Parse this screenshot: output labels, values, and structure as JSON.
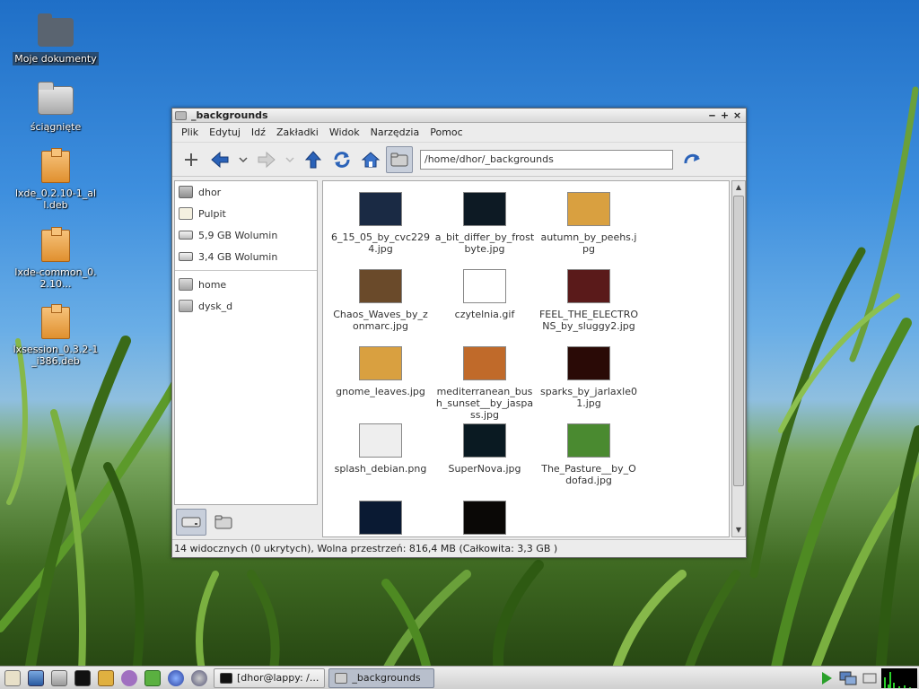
{
  "desktop": {
    "icons": [
      {
        "label": "Moje dokumenty",
        "type": "folder-home"
      },
      {
        "label": "ściągnięte",
        "type": "folder"
      },
      {
        "label": "lxde_0.2.10-1_all.deb",
        "type": "package"
      },
      {
        "label": "lxde-common_0.2.10...",
        "type": "package"
      },
      {
        "label": "lxsession_0.3.2-1_i386.deb",
        "type": "package"
      }
    ]
  },
  "window": {
    "title": "_backgrounds",
    "controls": {
      "minimize": "‒",
      "maximize": "+",
      "close": "×"
    },
    "menu": [
      "Plik",
      "Edytuj",
      "Idź",
      "Zakładki",
      "Widok",
      "Narzędzia",
      "Pomoc"
    ],
    "path": "/home/dhor/_backgrounds",
    "sidebar": {
      "places": [
        {
          "label": "dhor",
          "icon": "home-folder-icon"
        },
        {
          "label": "Pulpit",
          "icon": "desktop-icon"
        },
        {
          "label": "5,9 GB Wolumin",
          "icon": "drive-icon"
        },
        {
          "label": "3,4 GB Wolumin",
          "icon": "drive-icon"
        }
      ],
      "bookmarks": [
        {
          "label": "home",
          "icon": "folder-icon"
        },
        {
          "label": "dysk_d",
          "icon": "folder-icon"
        }
      ]
    },
    "files": [
      {
        "name": "6_15_05_by_cvc2294.jpg",
        "color": "#1a2a44"
      },
      {
        "name": "a_bit_differ_by_frostbyte.jpg",
        "color": "#0d1a24"
      },
      {
        "name": "autumn_by_peehs.jpg",
        "color": "#d9a040"
      },
      {
        "name": "Chaos_Waves_by_zonmarc.jpg",
        "color": "#6a4a2a"
      },
      {
        "name": "czytelnia.gif",
        "color": "#ffffff"
      },
      {
        "name": "FEEL_THE_ELECTRONS_by_sluggy2.jpg",
        "color": "#5a1a1a"
      },
      {
        "name": "gnome_leaves.jpg",
        "color": "#d9a040"
      },
      {
        "name": "mediterranean_bush_sunset__by_jaspass.jpg",
        "color": "#c06a2a"
      },
      {
        "name": "sparks_by_jarlaxle01.jpg",
        "color": "#2a0a06"
      },
      {
        "name": "splash_debian.png",
        "color": "#eeeeee"
      },
      {
        "name": "SuperNova.jpg",
        "color": "#0a1a22"
      },
      {
        "name": "The_Pasture__by_Odofad.jpg",
        "color": "#4a8a30"
      },
      {
        "name": "",
        "color": "#0a1a33"
      },
      {
        "name": "",
        "color": "#0a0806"
      }
    ],
    "status": "14 widocznych (0 ukrytych), Wolna przestrzeń: 816,4 MB (Całkowita: 3,3 GB )"
  },
  "taskbar": {
    "tasks": [
      {
        "label": "[dhor@lappy: /...",
        "active": false
      },
      {
        "label": "_backgrounds",
        "active": true
      }
    ]
  },
  "colors": {
    "accent": "#c8cfdb",
    "desktop_sky": "#3e8fde"
  }
}
